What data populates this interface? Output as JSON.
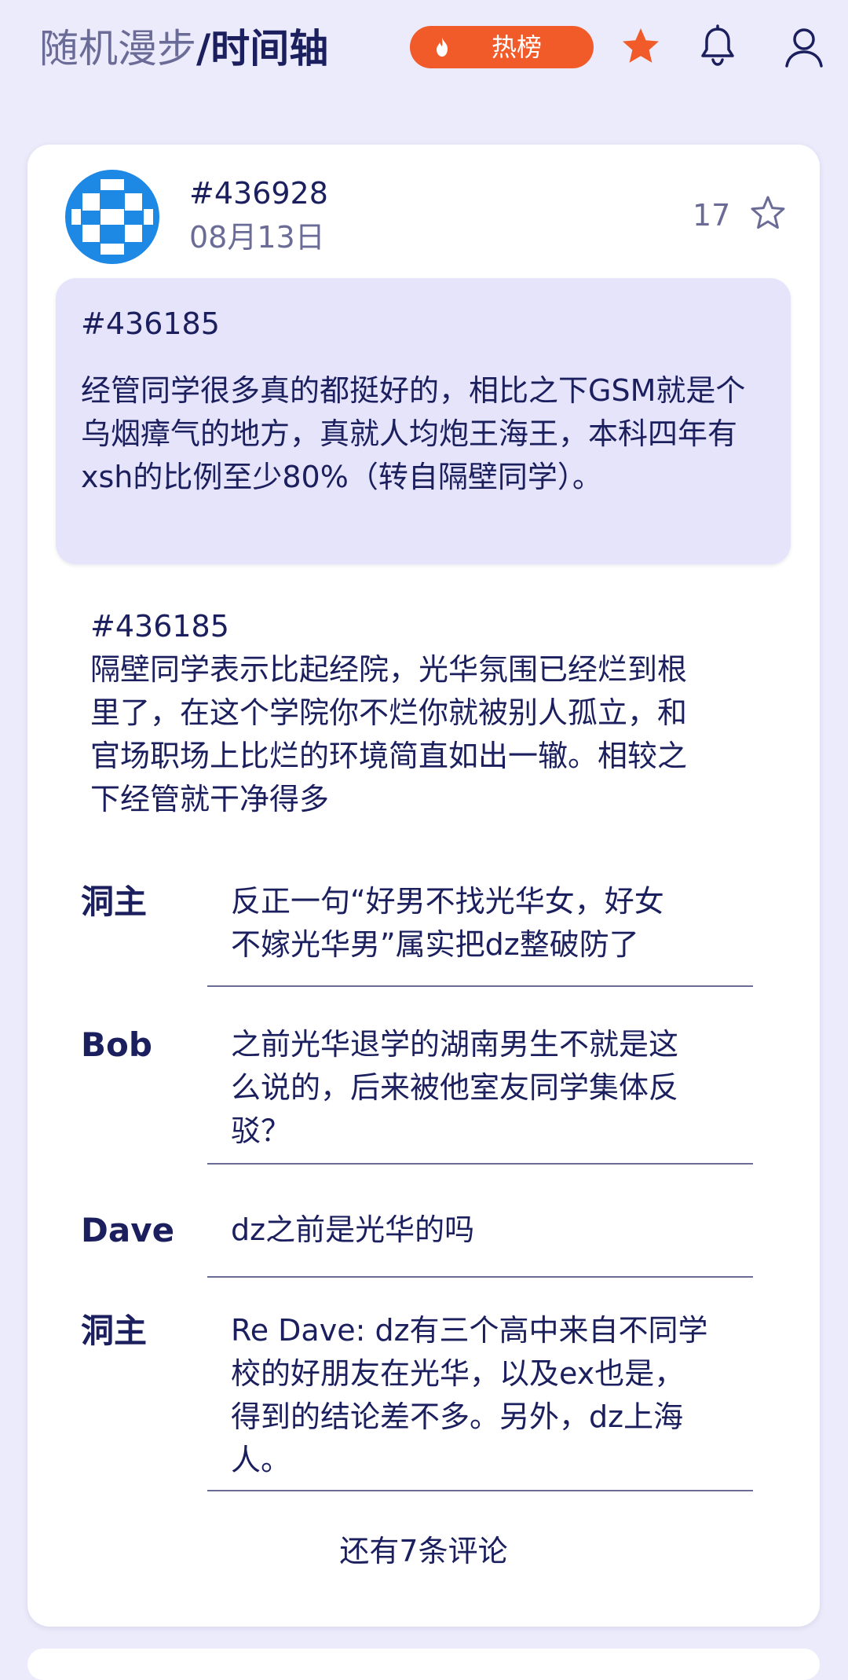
{
  "header": {
    "subtitle": "随机漫步",
    "separator": "/",
    "title": "时间轴",
    "hot_label": "热榜",
    "icons": [
      "flame-icon",
      "star-filled-icon",
      "bell-icon",
      "user-icon"
    ]
  },
  "colors": {
    "background": "#ecebfb",
    "accent": "#f15a29",
    "text": "#1b1f5e",
    "muted": "#6a6c97",
    "quote_bg": "#e6e4fb",
    "avatar": "#1e88e5"
  },
  "post": {
    "id": "#436928",
    "date": "08月13日",
    "likes": "17",
    "quote": {
      "id": "#436185",
      "text": "经管同学很多真的都挺好的，相比之下GSM就是个乌烟瘴气的地方，真就人均炮王海王，本科四年有xsh的比例至少80%（转自隔壁同学）。"
    },
    "body_lines": [
      "#436185",
      "隔壁同学表示比起经院，光华氛围已经烂到根",
      "里了，在这个学院你不烂你就被别人孤立，和",
      "官场职场上比烂的环境简直如出一辙。相较之",
      "下经管就干净得多"
    ],
    "comments": [
      {
        "name": "洞主",
        "lines": [
          "反正一句“好男不找光华女，好女",
          "不嫁光华男”属实把dz整破防了"
        ]
      },
      {
        "name": "Bob",
        "lines": [
          "之前光华退学的湖南男生不就是这",
          "么说的，后来被他室友同学集体反",
          "驳？"
        ]
      },
      {
        "name": "Dave",
        "lines": [
          "dz之前是光华的吗"
        ]
      },
      {
        "name": "洞主",
        "lines": [
          "Re Dave: dz有三个高中来自不同学",
          "校的好朋友在光华，以及ex也是，",
          "得到的结论差不多。另外，dz上海",
          "人。"
        ]
      }
    ],
    "more_comments": "还有7条评论"
  }
}
